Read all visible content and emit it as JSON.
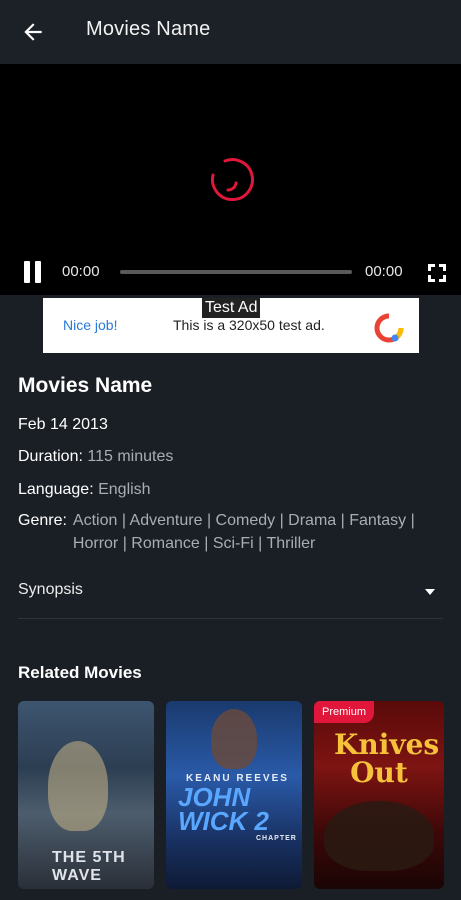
{
  "appbar": {
    "title": "Movies Name"
  },
  "player": {
    "current_time": "00:00",
    "duration": "00:00",
    "progress": 0.0
  },
  "ad": {
    "badge": "Test Ad",
    "nice": "Nice job!",
    "text": "This is a 320x50 test ad."
  },
  "movie": {
    "title": "Movies Name",
    "release_date": "Feb 14 2013",
    "duration_label": "Duration:",
    "duration_value": "115 minutes",
    "language_label": "Language:",
    "language_value": "English",
    "genre_label": "Genre:",
    "genre_value": "Action | Adventure | Comedy | Drama | Fantasy | Horror | Romance | Sci-Fi | Thriller"
  },
  "synopsis": {
    "label": "Synopsis"
  },
  "related": {
    "title": "Related Movies",
    "items": [
      {
        "poster_text": "THE 5TH WAVE",
        "badge": ""
      },
      {
        "poster_actor": "KEANU REEVES",
        "poster_title": "JOHN WICK 2",
        "poster_sub": "CHAPTER",
        "badge": ""
      },
      {
        "poster_title": "Knives Out",
        "badge": "Premium"
      }
    ]
  },
  "colors": {
    "background": "#1a1f26",
    "accent_red": "#e0173a",
    "ad_link": "#2979d9"
  }
}
